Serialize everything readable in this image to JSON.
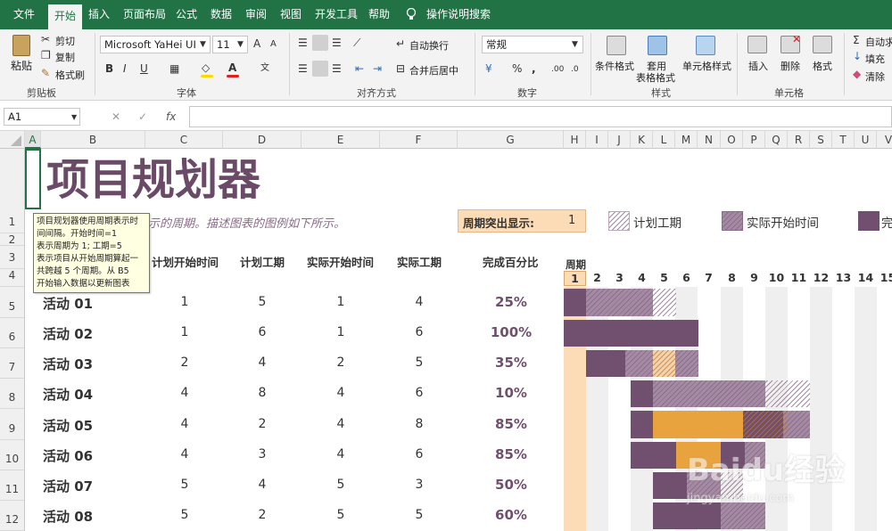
{
  "tabs": [
    "文件",
    "开始",
    "插入",
    "页面布局",
    "公式",
    "数据",
    "审阅",
    "视图",
    "开发工具",
    "帮助"
  ],
  "tell_me": "操作说明搜索",
  "clipboard": {
    "paste": "粘贴",
    "cut": "剪切",
    "copy": "复制",
    "format_painter": "格式刷",
    "label": "剪贴板"
  },
  "font": {
    "name": "Microsoft YaHei UI",
    "size": "11",
    "label": "字体",
    "bold": "B",
    "italic": "I",
    "underline": "U",
    "grow": "A",
    "shrink": "A",
    "font_color": "A",
    "wen": "文"
  },
  "alignment": {
    "wrap": "自动换行",
    "merge": "合并后居中",
    "label": "对齐方式"
  },
  "number": {
    "format": "常规",
    "percent": "%",
    "comma": ",",
    "label": "数字"
  },
  "styles": {
    "conditional": "条件格式",
    "table1": "套用",
    "table2": "表格格式",
    "cell_styles": "单元格样式",
    "label": "样式"
  },
  "cells": {
    "insert": "插入",
    "delete": "删除",
    "format": "格式",
    "label": "单元格"
  },
  "editing": {
    "autosum": "自动求",
    "fill": "填充",
    "clear": "清除"
  },
  "formula_bar": {
    "name_box": "A1",
    "fx": "fx",
    "cancel": "✕",
    "confirm": "✓"
  },
  "columns": [
    "A",
    "B",
    "C",
    "D",
    "E",
    "F",
    "G",
    "H",
    "I",
    "J",
    "K",
    "L",
    "M",
    "N",
    "O",
    "P",
    "Q",
    "R",
    "S",
    "T",
    "U",
    "V"
  ],
  "rows": [
    "1",
    "2",
    "3",
    "4",
    "5",
    "6",
    "7",
    "8",
    "9",
    "10",
    "11",
    "12"
  ],
  "sheet": {
    "title": "项目规划器",
    "subtitle": "示的周期。描述图表的图例如下所示。",
    "period_label": "周期突出显示:",
    "period_value": "1",
    "legend": [
      "计划工期",
      "实际开始时间",
      "完"
    ],
    "headers": [
      "计划开始时间",
      "计划工期",
      "实际开始时间",
      "实际工期",
      "完成百分比",
      "周期"
    ],
    "period_numbers": [
      "1",
      "2",
      "3",
      "4",
      "5",
      "6",
      "7",
      "8",
      "9",
      "10",
      "11",
      "12",
      "13",
      "14",
      "15"
    ],
    "activities": [
      {
        "name": "活动 01",
        "plan_start": "1",
        "plan_dur": "5",
        "act_start": "1",
        "act_dur": "4",
        "pct": "25%"
      },
      {
        "name": "活动 02",
        "plan_start": "1",
        "plan_dur": "6",
        "act_start": "1",
        "act_dur": "6",
        "pct": "100%"
      },
      {
        "name": "活动 03",
        "plan_start": "2",
        "plan_dur": "4",
        "act_start": "2",
        "act_dur": "5",
        "pct": "35%"
      },
      {
        "name": "活动 04",
        "plan_start": "4",
        "plan_dur": "8",
        "act_start": "4",
        "act_dur": "6",
        "pct": "10%"
      },
      {
        "name": "活动 05",
        "plan_start": "4",
        "plan_dur": "2",
        "act_start": "4",
        "act_dur": "8",
        "pct": "85%"
      },
      {
        "name": "活动 06",
        "plan_start": "4",
        "plan_dur": "3",
        "act_start": "4",
        "act_dur": "6",
        "pct": "85%"
      },
      {
        "name": "活动 07",
        "plan_start": "5",
        "plan_dur": "4",
        "act_start": "5",
        "act_dur": "3",
        "pct": "50%"
      },
      {
        "name": "活动 08",
        "plan_start": "5",
        "plan_dur": "2",
        "act_start": "5",
        "act_dur": "5",
        "pct": "60%"
      }
    ],
    "tooltip": [
      "项目规划器使用周期表示时",
      "间间隔。开始时间=1",
      "表示周期为 1; 工期=5",
      "表示项目从开始周期算起一",
      "共跨越 5 个周期。从 B5",
      "开始输入数据以更新图表"
    ]
  },
  "watermark": {
    "brand": "Baidu经验",
    "url": "jingyan.baidu.com"
  },
  "colors": {
    "excel_green": "#217346",
    "plum": "#70506e",
    "orange": "#e8a33e",
    "highlight": "#fbdcb6",
    "title": "#6b4a68"
  }
}
